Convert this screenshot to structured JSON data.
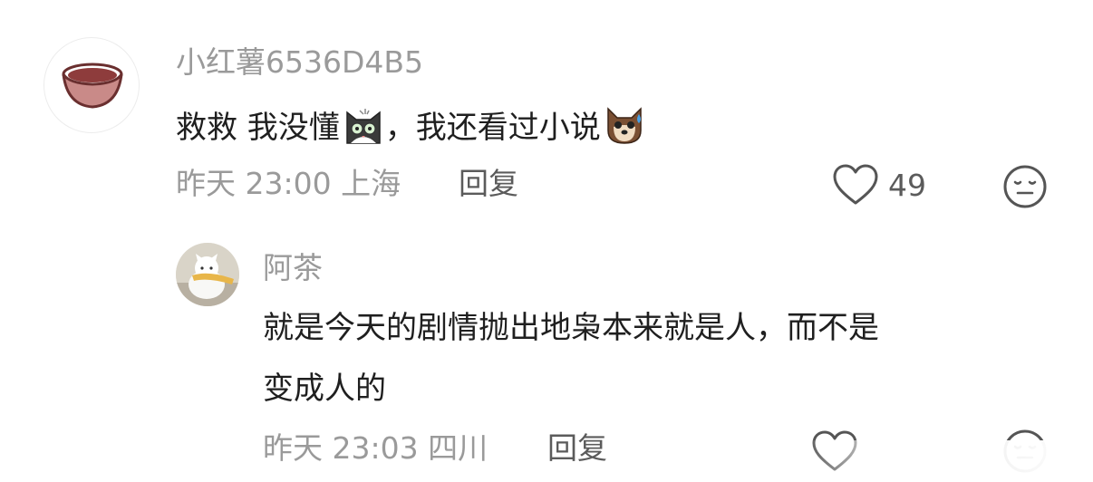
{
  "comment": {
    "username": "小红薯6536D4B5",
    "text_part1": "救救 我没懂",
    "text_part2": "，我还看过小说",
    "emoji_1": "cat-face-emoji",
    "emoji_2": "dog-face-sweat-emoji",
    "time_location": "昨天 23:00 上海",
    "reply_label": "回复",
    "like_count": "49",
    "icons": {
      "like": "heart-outline-icon",
      "dislike": "expressionless-face-icon"
    }
  },
  "reply": {
    "username": "阿茶",
    "text_line1": "就是今天的剧情抛出地枭本来就是人，而不是",
    "text_line2": "变成人的",
    "time_location": "昨天 23:03 四川",
    "reply_label": "回复"
  },
  "colors": {
    "secondary_text": "#9a9a9a",
    "primary_text": "#1f1f1f",
    "action_text": "#5b5b5b"
  }
}
